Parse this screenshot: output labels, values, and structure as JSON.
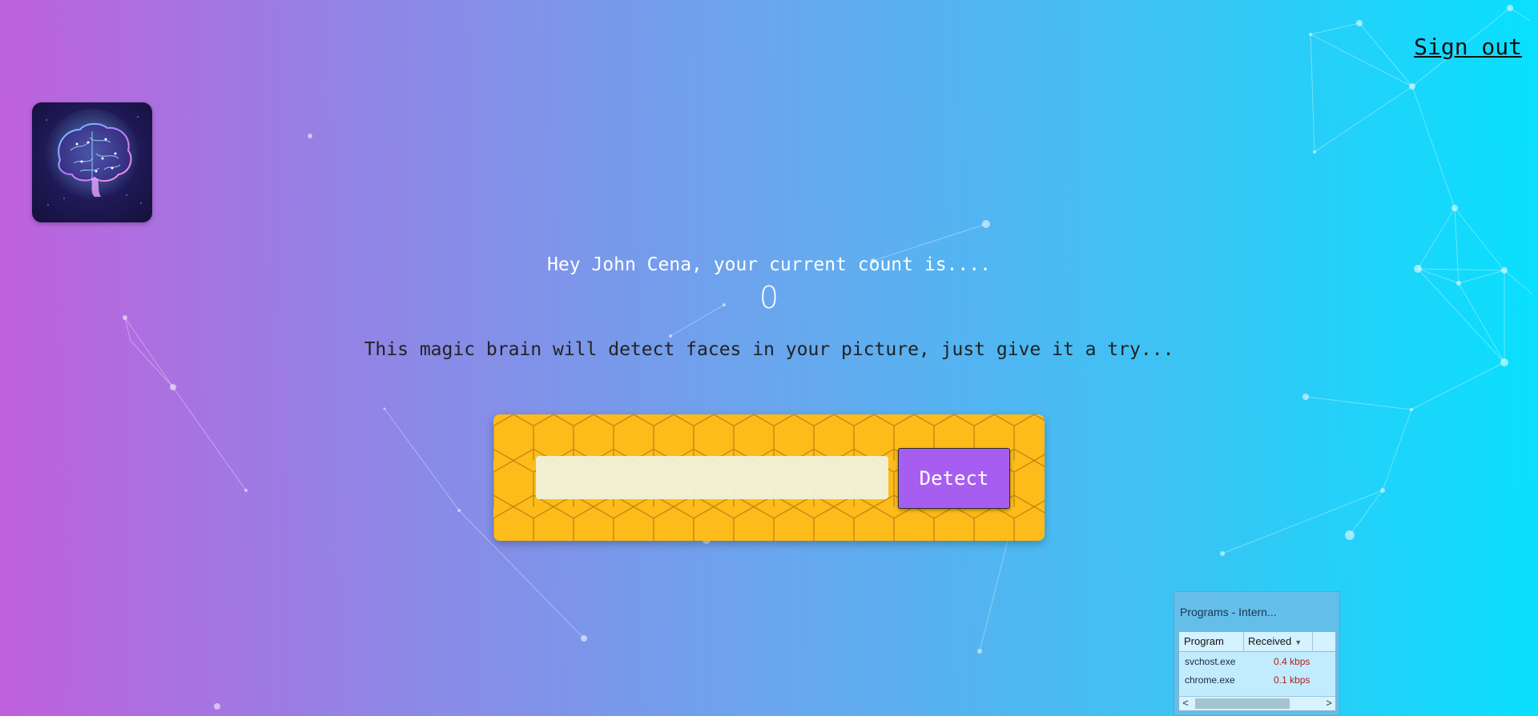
{
  "nav": {
    "signout_label": "Sign out"
  },
  "logo": {
    "icon": "brain-logo-icon"
  },
  "rank": {
    "greeting": "Hey John Cena, your current count is....",
    "count": "0"
  },
  "form": {
    "intro_text": "This magic brain will detect faces in your picture, just give it a try...",
    "input_value": "",
    "detect_label": "Detect",
    "panel_color": "#fdbc1a",
    "button_color": "#a75ef0"
  },
  "network_monitor": {
    "title": "Programs - Intern...",
    "columns": [
      "Program",
      "Received"
    ],
    "rows": [
      {
        "program": "svchost.exe",
        "received": "0.4 kbps"
      },
      {
        "program": "chrome.exe",
        "received": "0.1 kbps"
      }
    ],
    "scroll_left": "<",
    "scroll_right": ">"
  },
  "theme": {
    "gradient_left": "#c060dc",
    "gradient_right": "#08e0fe"
  }
}
